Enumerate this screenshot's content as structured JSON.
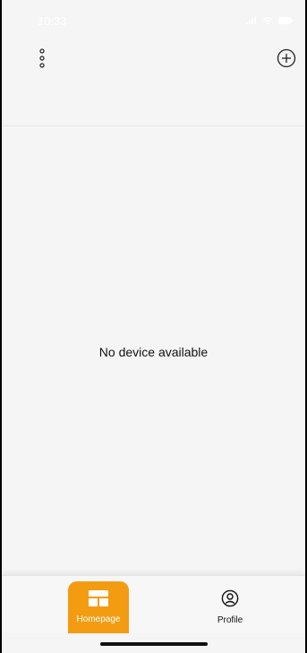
{
  "status_bar": {
    "time": "10:33"
  },
  "header": {
    "menu_icon": "vertical-dots-icon",
    "add_icon": "plus-circle-icon"
  },
  "content": {
    "empty_message": "No device available"
  },
  "tab_bar": {
    "accent_color": "#f39c12",
    "items": [
      {
        "label": "Homepage",
        "icon": "grid-icon",
        "active": true
      },
      {
        "label": "Profile",
        "icon": "user-circle-icon",
        "active": false
      }
    ]
  }
}
